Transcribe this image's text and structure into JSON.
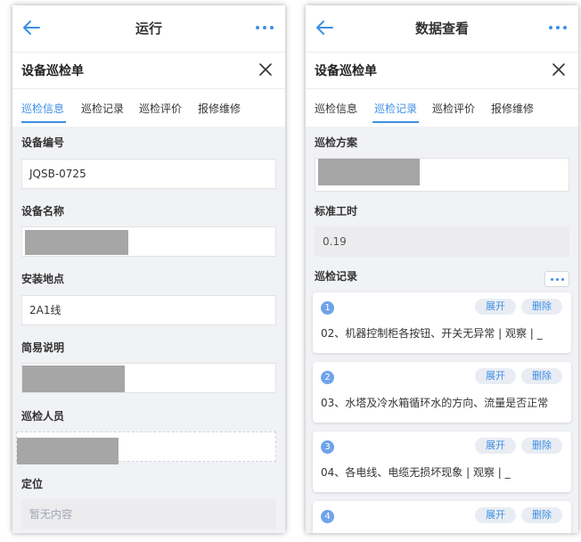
{
  "left": {
    "topbar": {
      "title": "运行",
      "back": "back-arrow-icon",
      "more": "more-dots-icon"
    },
    "sheet_title": "设备巡检单",
    "tabs": [
      {
        "label": "巡检信息",
        "active": true
      },
      {
        "label": "巡检记录",
        "active": false
      },
      {
        "label": "巡检评价",
        "active": false
      },
      {
        "label": "报修维修",
        "active": false
      }
    ],
    "fields": {
      "device_no_label": "设备编号",
      "device_no_value": "JQSB-0725",
      "device_name_label": "设备名称",
      "install_location_label": "安装地点",
      "install_location_value": "2A1线",
      "brief_desc_label": "简易说明",
      "inspector_label": "巡检人员",
      "location_label": "定位",
      "location_placeholder": "暂无内容"
    }
  },
  "right": {
    "topbar": {
      "title": "数据查看",
      "back": "back-arrow-icon",
      "more": "more-dots-icon"
    },
    "sheet_title": "设备巡检单",
    "tabs": [
      {
        "label": "巡检信息",
        "active": false
      },
      {
        "label": "巡检记录",
        "active": true
      },
      {
        "label": "巡检评价",
        "active": false
      },
      {
        "label": "报修维修",
        "active": false
      }
    ],
    "plan_label": "巡检方案",
    "std_hours_label": "标准工时",
    "std_hours_value": "0.19",
    "records_label": "巡检记录",
    "records": [
      {
        "index": "1",
        "expand": "展开",
        "delete": "删除",
        "text": "02、机器控制柜各按钮、开关无异常 | 观察 | _"
      },
      {
        "index": "2",
        "expand": "展开",
        "delete": "删除",
        "text": "03、水塔及冷水箱循环水的方向、流量是否正常"
      },
      {
        "index": "3",
        "expand": "展开",
        "delete": "删除",
        "text": "04、各电线、电缆无损坏现象 | 观察 | _"
      },
      {
        "index": "4",
        "expand": "展开",
        "delete": "删除",
        "text": ""
      }
    ]
  },
  "colors": {
    "accent": "#3d8fe5",
    "badge": "#6fa3e9",
    "redaction": "#a6a6a6"
  }
}
